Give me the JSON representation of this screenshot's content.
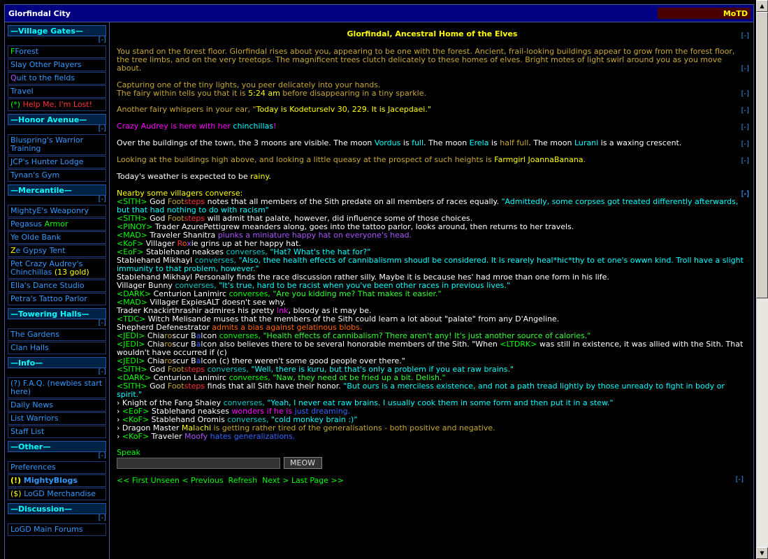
{
  "window": {
    "title": "Glorfindal City",
    "motd": "MoTD"
  },
  "collapse": "[-]",
  "nav": {
    "village_gates": "Village Gates",
    "forest": "Forest",
    "slay": "Slay Other Players",
    "quit_q": "Q",
    "quit_rest": "uit to the fields",
    "travel": "Travel",
    "help_star": "(*)",
    "help": " Help Me, I'm Lost!",
    "honor_avenue": "Honor Avenue",
    "bluspring": "Bluspring's Warrior Training",
    "jcp": "JCP's Hunter Lodge",
    "tynan": "Tynan's Gym",
    "mercantile": "Mercantile",
    "mightye": "MightyE's Weaponry",
    "mightye_w": "W",
    "pegasus_a": "Pegasus ",
    "pegasus_b": "Armor",
    "bank": "Ye Olde Bank",
    "gypsy_z": "Z",
    "gypsy_rest": "e Gypsy Tent",
    "pet": "Pet Crazy Audrey's Chinchillas",
    "pet_gold": "(13 gold)",
    "ella": "Ella's Dance Studio",
    "petra": "Petra's Tattoo Parlor",
    "towering_halls": "Towering Halls",
    "gardens": "The Gardens",
    "clan": "Clan Halls",
    "info": "Info",
    "faq": "(?) F.A.Q. (newbies start here)",
    "news": "Daily News",
    "warriors": "List Warriors",
    "staff": "Staff List",
    "other": "Other",
    "prefs": "Preferences",
    "blogs_prefix": "(!)",
    "blogs": " MightyBlogs",
    "merch_prefix": "($)",
    "merch": " LoGD Merchandise",
    "discussion": "Discussion",
    "forums": "LoGD Main Forums"
  },
  "main": {
    "heading": "Glorfindal, Ancestral Home of the Elves",
    "p1": "You stand on the forest floor. Glorfindal rises about you, appearing to be one with the forest. Ancient, frail-looking buildings appear to grow from the forest floor, the tree limbs, and on the very treetops. The magnificent trees clutch delicately to these homes of elves. Bright motes of light swirl around you as you move about.",
    "p2a": "Capturing one of the tiny lights, you peer delicately into your hands.",
    "p2b": "The fairy within tells you that it is ",
    "p2time": "5:24 am",
    "p2c": " before disappearing in a tiny sparkle.",
    "p3a": "Another fairy whispers in your ear, \"",
    "p3b": "Today is ",
    "p3c": "Kodeturselv 30, 229",
    "p3d": ". It is ",
    "p3e": "Jacepdaei",
    "p3f": ".\"",
    "p4a": "Crazy Audrey is here with her ",
    "p4b": "chinchillas",
    "p4c": "!",
    "p5a": "Over the buildings of the town, the 3 moons are visible. The moon ",
    "p5b": "Vordus",
    "p5c": " is ",
    "p5d": "full",
    "p5e": ". The moon ",
    "p5f": "Erela",
    "p5g": " is ",
    "p5h": "half full",
    "p5i": ". The moon ",
    "p5j": "Lurani",
    "p5k": " is a waxing crescent.",
    "p6a": "Looking at the buildings high above, and looking a little queasy at the prospect of such heights is ",
    "p6b": "Farmgirl JoannaBanana",
    "p6c": ".",
    "p7a": "Today's weather is expected to be ",
    "p7b": "rainy",
    "p7c": ".",
    "converse": "Nearby some villagers converse:"
  },
  "chat": [
    {
      "tag": "<SITH>",
      "speaker_a": " God ",
      "speaker_b": "Foot",
      "speaker_c": "steps",
      "rest_w": " notes that all members of the Sith predate on all members of races equally. ",
      "rest_c": "\"Admittedly, some corpses got treated differently afterwards, but that had nothing to do with racism\""
    },
    {
      "tag": "<SITH>",
      "speaker_a": " God ",
      "speaker_b": "Foot",
      "speaker_c": "steps",
      "rest_w": " will admit that palate, however, did influence some of those choices.",
      "rest_c": ""
    },
    {
      "tag": "<PINOY>",
      "text": " Trader AzurePettigrew meanders along, goes into the tattoo parlor, looks around, then returns to her travels."
    },
    {
      "tag": "<MAD>",
      "text": " Traveler Shanitra ",
      "purple": "plunks a miniature happy hat on everyone's head."
    },
    {
      "tag": "<KoF>",
      "text_a": " Villager ",
      "r": "R",
      "o": "o",
      "x": "x",
      "ie": "ie",
      "text_b": " grins up at her happy hat."
    },
    {
      "tag": "<EoF>",
      "text": " Stablehand neakses ",
      "conv": "converses, ",
      "quote": "\"Hat? What's the hat for?\""
    },
    {
      "text": "Stablehand Mikhayl ",
      "conv": "converses, ",
      "quote": "\"Also, thee health effects of cannibalismm shoudl be considered. It is rearely heal*hic*thy to et one's owwn kind. Troll have a slight immunity to that problem, however.\""
    },
    {
      "text": "Stablehand Mikhayl Personally finds the race discussion rather silly. Maybe it is because hes' had mroe than one form in his life."
    },
    {
      "text": "Villager Bunny ",
      "conv": "converses, ",
      "quote": "\"It's true, hard to be racist when you've been other races in previous lives.\""
    },
    {
      "tag": "<DARK>",
      "text": " Centurion Lanimirc ",
      "conv": "converses, ",
      "quote": "\"Are you kidding me? That makes it easier.\""
    },
    {
      "tag": "<MAD>",
      "text": " Villager ExpiesALT doesn't see why."
    },
    {
      "text": "Trader Knackirthrashir admires his pretty ",
      "mag": "ink",
      "rest": ", bloody as it may be."
    },
    {
      "tag": "<TDC>",
      "text": " Witch Melisande muses that the members of the Sith could learn a lot about \"palate\" from any D'Angeline."
    },
    {
      "text": "Shepherd Defenestrator ",
      "orange": "admits a bias against gelatinous blobs."
    },
    {
      "tag": "<JEDI>",
      "a": " Chia",
      "b": "ro",
      "c": "scur B",
      "d": "a",
      "e": "lcon ",
      "conv": "converses, ",
      "quote": "\"Health effects of cannibalism? There aren't any! It's just another source of calories.\""
    },
    {
      "tag": "<JEDI>",
      "a": " Chia",
      "b": "ro",
      "c": "scur B",
      "d": "a",
      "e": "lcon",
      "rest_a": " also believes there to be several honorable members of the Sith. \"When ",
      "ltdrk": "<LTDRK>",
      "rest_b": " was still in existence, it was allied with the Sith. That wouldn't have occurred if (c)"
    },
    {
      "tag": "<JEDI>",
      "a": " Chia",
      "b": "ro",
      "c": "scur B",
      "d": "a",
      "e": "lcon",
      "rest_a": " (c) there weren't some good people over there.\""
    },
    {
      "tag": "<SITH>",
      "speaker_a": " God ",
      "speaker_b": "Foot",
      "speaker_c": "steps",
      "conv": " converses, ",
      "quote": "\"Well, there is kuru, but that's only a problem if you eat raw brains.\""
    },
    {
      "tag": "<DARK>",
      "text": " Centurion Lanimirc ",
      "conv": "converses, ",
      "quote": "\"Naw, they need ot be fried up a bit. Delish.\""
    },
    {
      "tag": "<SITH>",
      "speaker_a": " God ",
      "speaker_b": "Foot",
      "speaker_c": "steps",
      "rest_w": " finds that all Sith have their honor. ",
      "rest_c": "\"But ours is a merciless existence, and not a path tread lightly by those unready to fight in body or spirit.\""
    },
    {
      "mark": "›",
      "text": " Knight of the Fang Shaiey ",
      "conv": "converses, ",
      "quote": "\"Yeah, I never eat raw brains. I usually cook them in some form and then put it in a stew.\""
    },
    {
      "mark": "›",
      "tag": "<EoF>",
      "text": " Stablehand neakses ",
      "mag": "wonders if he is ",
      "blue": "just dreaming."
    },
    {
      "mark": "›",
      "tag": "<KoF>",
      "text": " Stablehand Oromis ",
      "conv": "converses, ",
      "quote": "\"cold monkey brain :)\""
    },
    {
      "mark": "›",
      "text": " Dragon Master ",
      "mal_a": "Mal",
      "mal_b": "a",
      "mal_c": "chi",
      "gold": " is getting rather tired of the generalisations - both positive and negative."
    },
    {
      "mark": "›",
      "tag": "<KoF>",
      "text": " Traveler ",
      "moofy": "Moofy",
      "blue": " hates generalizations."
    }
  ],
  "speak": {
    "label": "Speak",
    "value": "",
    "button": "MEOW"
  },
  "pager": {
    "first": "<< First Unseen",
    "prev": "< Previous",
    "refresh": "Refresh",
    "next": "Next >",
    "last": "Last Page >>"
  },
  "colors": {
    "nav_bg": "#000080",
    "accent": "#00ffff",
    "motd_bg": "#4a0000"
  }
}
